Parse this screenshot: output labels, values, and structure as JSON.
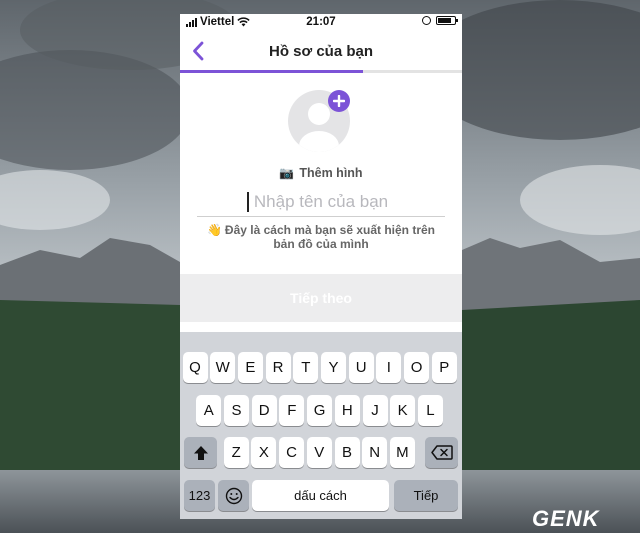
{
  "status_bar": {
    "carrier": "Viettel",
    "time": "21:07",
    "wifi_icon": "wifi-icon",
    "battery_icon": "battery-icon"
  },
  "nav": {
    "back_icon": "chevron-left-icon",
    "title": "Hồ sơ của bạn",
    "progress": 0.65
  },
  "profile": {
    "add_photo_label": "Thêm hình",
    "add_photo_icon": "camera-icon",
    "name_placeholder": "Nhập tên của bạn",
    "name_value": "",
    "hint_icon": "waving-hand-icon",
    "hint_line1": "Đây là cách mà bạn sẽ xuất hiện trên",
    "hint_line2": "bản đồ của mình"
  },
  "next_button": {
    "label": "Tiếp theo"
  },
  "keyboard": {
    "row1": [
      "Q",
      "W",
      "E",
      "R",
      "T",
      "Y",
      "U",
      "I",
      "O",
      "P"
    ],
    "row2": [
      "A",
      "S",
      "D",
      "F",
      "G",
      "H",
      "J",
      "K",
      "L"
    ],
    "row3": [
      "Z",
      "X",
      "C",
      "V",
      "B",
      "N",
      "M"
    ],
    "numbers_label": "123",
    "space_label": "dấu cách",
    "return_label": "Tiếp",
    "shift_icon": "shift-icon",
    "backspace_icon": "backspace-icon",
    "emoji_icon": "emoji-icon"
  },
  "watermark": {
    "text": "GENK"
  },
  "colors": {
    "accent": "#7c53d7",
    "keyboard_bg": "#d1d4d9",
    "key_dark": "#abb1ba"
  }
}
